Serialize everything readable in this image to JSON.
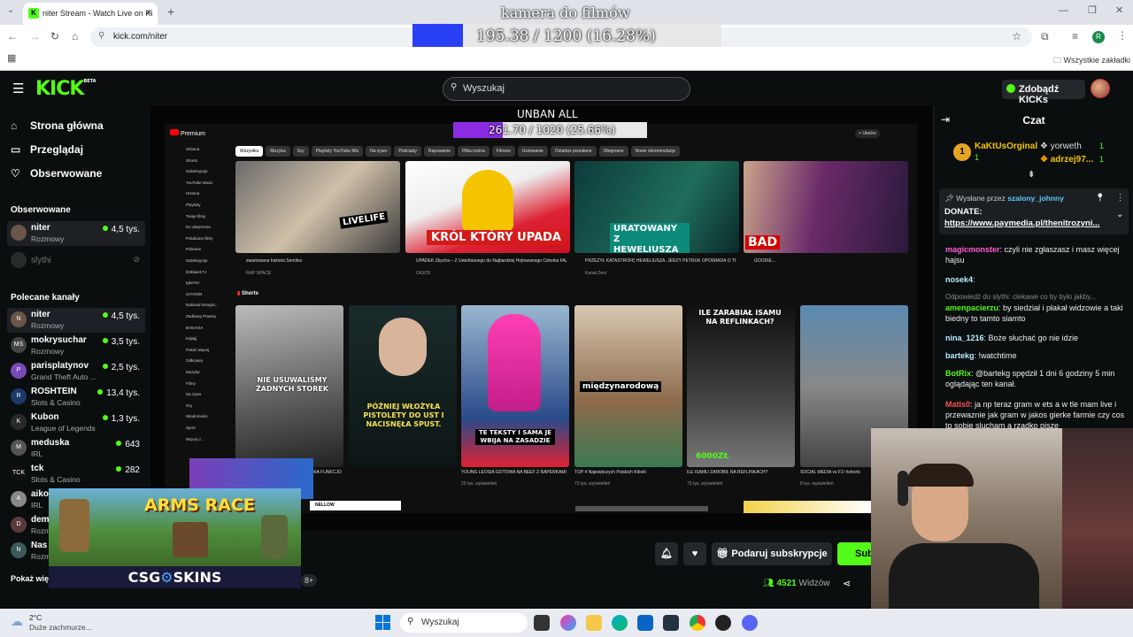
{
  "browser": {
    "tab_title": "niter Stream - Watch Live on Ki",
    "tab_favicon": "K",
    "url": "kick.com/niter",
    "bookmarks_label": "Wszystkie zakładki",
    "new_tab": "+",
    "profile_initial": "R"
  },
  "overlays": {
    "top_goal_label": "kamera do filmów",
    "top_goal_progress": "195.38 / 1200 (16.28%)",
    "top_goal_fraction": 0.1628,
    "unban_label": "UNBAN ALL",
    "unban_progress": "261.70 / 1020 (25.66%)",
    "unban_fraction": 0.2566
  },
  "kick": {
    "logo": "KICK",
    "logo_beta": "BETA",
    "search_placeholder": "Wyszukaj",
    "kicks_button": "Zdobądź KICKs"
  },
  "sidebar": {
    "nav": [
      {
        "label": "Strona główna",
        "icon": "home-icon"
      },
      {
        "label": "Przeglądaj",
        "icon": "browse-icon"
      },
      {
        "label": "Obserwowane",
        "icon": "heart-icon"
      }
    ],
    "followed_header": "Obserwowane",
    "followed": [
      {
        "name": "niter",
        "category": "Rozmowy",
        "viewers": "4,5 tys."
      },
      {
        "name": "slythi",
        "category": "",
        "viewers": ""
      }
    ],
    "recommended_header": "Polecane kanały",
    "recommended": [
      {
        "name": "niter",
        "category": "Rozmowy",
        "viewers": "4,5 tys.",
        "avatar": "N"
      },
      {
        "name": "mokrysuchar",
        "category": "Rozmowy",
        "viewers": "3,5 tys.",
        "avatar": "MS"
      },
      {
        "name": "parisplatynov",
        "category": "Grand Theft Auto ...",
        "viewers": "2,5 tys.",
        "avatar": "P"
      },
      {
        "name": "ROSHTEIN",
        "category": "Slots & Casino",
        "viewers": "13,4 tys.",
        "avatar": "R"
      },
      {
        "name": "Kubon",
        "category": "League of Legends",
        "viewers": "1,3 tys.",
        "avatar": "K"
      },
      {
        "name": "meduska",
        "category": "IRL",
        "viewers": "643",
        "avatar": "M"
      },
      {
        "name": "tck",
        "category": "Slots & Casino",
        "viewers": "282",
        "avatar": "TCK"
      },
      {
        "name": "aiko",
        "category": "IRL",
        "viewers": "",
        "avatar": "A"
      },
      {
        "name": "dem",
        "category": "Rozm",
        "viewers": "",
        "avatar": "D"
      },
      {
        "name": "Nas",
        "category": "Rozm",
        "viewers": "",
        "avatar": "N"
      }
    ],
    "show_more": "Pokaż więc"
  },
  "youtube": {
    "logo": "Premium",
    "chips": [
      "Wszystko",
      "Muzyka",
      "Gry",
      "Playlisty YouTube Mix",
      "Na żywo",
      "Podcasty",
      "Rapowanie",
      "Piłka nożna",
      "Fitness",
      "Gotowanie",
      "Ostatnio przesłane",
      "Obejrzane",
      "Nowe rekomendacje"
    ],
    "side_items": [
      "Główna",
      "Shorts",
      "Subskrypcje",
      "YouTube Music",
      "Historia",
      "Playlisty",
      "Twoje filmy",
      "Do obejrzenia",
      "Polubione filmy",
      "Pobrane",
      "Subskrypcje",
      "bOblast1TJ",
      "tgknHU",
      "SAYSON",
      "National Geogra...",
      "Zadkowy Prawny",
      "BANAISA",
      "Kajtajj",
      "Pokaż więcej",
      "Odkrywaj",
      "Muzyka",
      "Filmy",
      "Na żywo",
      "Gry",
      "Wiadomości",
      "Sport",
      "Więcej z..."
    ],
    "videos": [
      {
        "title": "zwariowana historia Semlino",
        "meta": "RAP SPACE",
        "thumb_text": "LIVELIFE"
      },
      {
        "title": "UPADEK Zbycha – Z Uwielbianego do Najbardziej Hejtowanego Członka FAZY",
        "meta": "OIGOS",
        "thumb_text": "KRÓL KTÓRY UPADA"
      },
      {
        "title": "PRZEŻYŁ KATASTROFĘ HEWELIUSZA. JERZY PETRUK OPOWIADA O TRAGEDII POLSKIEGO STATKU",
        "meta": "Kanał Zero",
        "thumb_text": "URATOWANY Z HEWELIUSZA"
      },
      {
        "title": "GOODIE...",
        "meta": "",
        "thumb_text": "BAD"
      }
    ],
    "shorts_label": "Shorts",
    "shorts": [
      {
        "title": "MAKABRA POD POZNANIEM! 30-LETNIA FUNKCJONARIUSZKA ZABIŁA WŁASNE DZIECKO I...",
        "views": "19 tys. wyświetleń",
        "thumb_text": "NIE USUWALIŚMY ŻADNYCH STOREK"
      },
      {
        "title": "",
        "views": "",
        "thumb_text": "PÓŹNIEJ WŁOŻYŁA PISTOLETY DO UST I NACISNĘŁA SPUST."
      },
      {
        "title": "YOUNG LEOSIA GOTOWA NA BEEF Z RAPERKAMI",
        "views": "23 tys. wyświetleń",
        "thumb_text": "TE TEKSTY I SAMA JE WBIJA NA ZASADZIE"
      },
      {
        "title": "TOP 4 Największych Polskich Kibolii",
        "views": "73 tys. wyświetleń",
        "thumb_text": "międzynarodową"
      },
      {
        "title": "ILE ISAMU ZAROBIŁ NA REFLINKACH?",
        "views": "73 tys. wyświetleń",
        "thumb_text": "ILE ZARABIAŁ ISAMU NA REFLINKACH?"
      },
      {
        "title": "SOCIAL MEDIA vs F1! #shorts",
        "views": "8 tys. wyświetleń",
        "thumb_text": ""
      }
    ],
    "thumb_price": "6000ZŁ",
    "upload_label": "Utwórz",
    "nellow_label": "NELLOW"
  },
  "ad": {
    "game_title": "ARMS RACE",
    "brand": "CSG",
    "brand_suffix": "SKINS",
    "badge": "8+"
  },
  "below_video": {
    "gift_button": "Podaruj subskrypcje",
    "subscribe_button": "Sub",
    "viewers_count": "4521",
    "viewers_label": "Widzów"
  },
  "chat": {
    "title": "Czat",
    "top_gifters": [
      {
        "rank": "1",
        "name": "KaKtUsOrginal",
        "count": "1"
      },
      {
        "name": "yorweth",
        "count": "1"
      },
      {
        "name": "adrzej97...",
        "count": "1"
      }
    ],
    "pinned_by_label": "Wysłane przez",
    "pinned_by_user": "szalony_johnny",
    "pinned_title": "DONATE:",
    "pinned_link": "https://www.paymedia.pl/thenitrozyni...",
    "messages": [
      {
        "user": "magicmonster",
        "text": ": czyli nie zgłaszasz i masz więcej hajsu",
        "color": "#ff5ed4"
      },
      {
        "user": "nosek4",
        "text": ":",
        "color": "#b7f0ff"
      },
      {
        "user": "",
        "text": "Odpowiedź do slythi: ciekawe co by było jakby...",
        "color": "#888"
      },
      {
        "user": "amenpacierzu",
        "text": ": by siedział i płakał widzowie a taki biedny to tamto siamto",
        "color": "#53fc18"
      },
      {
        "user": "nina_1216",
        "text": ": Boże słuchać go nie idzie",
        "color": "#b7f0ff"
      },
      {
        "user": "bartekg",
        "text": ": !watchtime",
        "color": "#b7f0ff"
      },
      {
        "user": "BotRix",
        "text": ": @bartekg spędził 1 dni 6 godziny 5 min oglądając ten kanał.",
        "color": "#53fc18"
      },
      {
        "user": "Matis0",
        "text": ": ja np teraz gram w ets a w tle mam live i przewaznie jak gram w jakos gierke farmie czy cos to sobie slucham a rzadko pisze",
        "color": "#ff5050"
      }
    ]
  },
  "taskbar": {
    "weather_temp": "2°C",
    "weather_desc": "Duże zachmurze...",
    "search_placeholder": "Wyszukaj"
  },
  "colors": {
    "kick_green": "#53fc18",
    "background": "#0b0e0f",
    "panel": "#24272c"
  }
}
